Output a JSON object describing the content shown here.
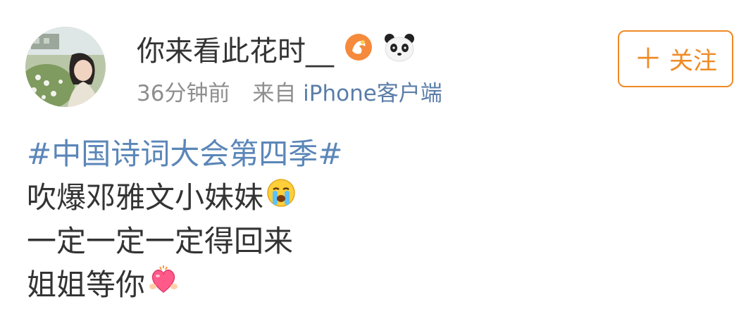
{
  "user": {
    "name": "你来看此花时__",
    "avatar_icon": "user-avatar-photo",
    "badges": [
      "orange-badge-icon",
      "panda-icon"
    ]
  },
  "meta": {
    "time": "36分钟前",
    "from_label": "来自",
    "source": "iPhone客户端"
  },
  "follow_button": {
    "plus": "＋",
    "label": "关注"
  },
  "post": {
    "topic": "#中国诗词大会第四季#",
    "line1": "吹爆邓雅文小妹妹",
    "line2": "一定一定一定得回来",
    "line3": "姐姐等你"
  },
  "colors": {
    "accent": "#f08a24",
    "link": "#5b86b8",
    "meta": "#8e8e8e",
    "text": "#333333"
  }
}
